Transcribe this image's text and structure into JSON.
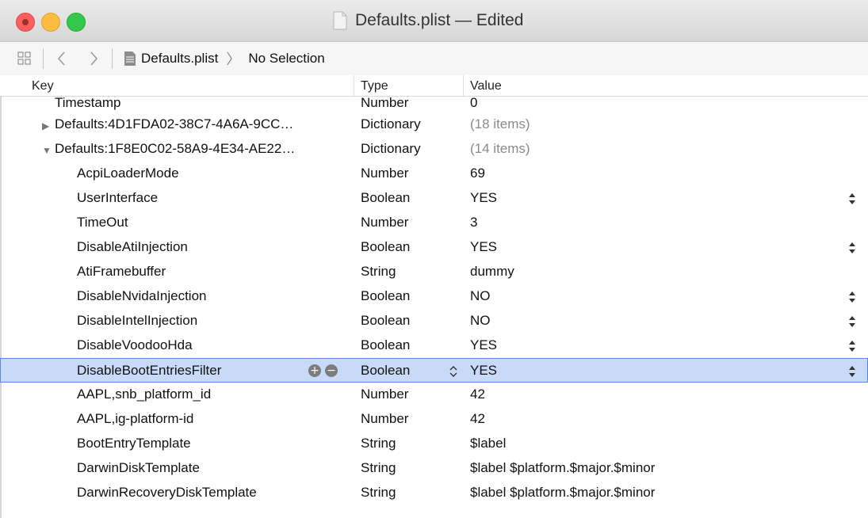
{
  "window": {
    "title": "Defaults.plist — Edited"
  },
  "pathbar": {
    "file": "Defaults.plist",
    "selection": "No Selection"
  },
  "columns": {
    "key": "Key",
    "type": "Type",
    "value": "Value"
  },
  "rows": [
    {
      "key": "Timestamp",
      "type": "Number",
      "value": "0",
      "indent": 1,
      "disclosure": "",
      "muted": false,
      "stepper": false
    },
    {
      "key": "Defaults:4D1FDA02-38C7-4A6A-9CC…",
      "type": "Dictionary",
      "value": "(18 items)",
      "indent": 0,
      "disclosure": "collapsed",
      "muted": true,
      "stepper": false
    },
    {
      "key": "Defaults:1F8E0C02-58A9-4E34-AE22…",
      "type": "Dictionary",
      "value": "(14 items)",
      "indent": 0,
      "disclosure": "expanded",
      "muted": true,
      "stepper": false
    },
    {
      "key": "AcpiLoaderMode",
      "type": "Number",
      "value": "69",
      "indent": 2,
      "disclosure": "",
      "muted": false,
      "stepper": false
    },
    {
      "key": "UserInterface",
      "type": "Boolean",
      "value": "YES",
      "indent": 2,
      "disclosure": "",
      "muted": false,
      "stepper": true
    },
    {
      "key": "TimeOut",
      "type": "Number",
      "value": "3",
      "indent": 2,
      "disclosure": "",
      "muted": false,
      "stepper": false
    },
    {
      "key": "DisableAtiInjection",
      "type": "Boolean",
      "value": "YES",
      "indent": 2,
      "disclosure": "",
      "muted": false,
      "stepper": true
    },
    {
      "key": "AtiFramebuffer",
      "type": "String",
      "value": "dummy",
      "indent": 2,
      "disclosure": "",
      "muted": false,
      "stepper": false
    },
    {
      "key": "DisableNvidaInjection",
      "type": "Boolean",
      "value": "NO",
      "indent": 2,
      "disclosure": "",
      "muted": false,
      "stepper": true
    },
    {
      "key": "DisableIntelInjection",
      "type": "Boolean",
      "value": "NO",
      "indent": 2,
      "disclosure": "",
      "muted": false,
      "stepper": true
    },
    {
      "key": "DisableVoodooHda",
      "type": "Boolean",
      "value": "YES",
      "indent": 2,
      "disclosure": "",
      "muted": false,
      "stepper": true
    },
    {
      "key": "DisableBootEntriesFilter",
      "type": "Boolean",
      "value": "YES",
      "indent": 2,
      "disclosure": "",
      "muted": false,
      "stepper": true,
      "selected": true
    },
    {
      "key": "AAPL,snb_platform_id",
      "type": "Number",
      "value": "42",
      "indent": 2,
      "disclosure": "",
      "muted": false,
      "stepper": false
    },
    {
      "key": "AAPL,ig-platform-id",
      "type": "Number",
      "value": "42",
      "indent": 2,
      "disclosure": "",
      "muted": false,
      "stepper": false
    },
    {
      "key": "BootEntryTemplate",
      "type": "String",
      "value": "$label",
      "indent": 2,
      "disclosure": "",
      "muted": false,
      "stepper": false
    },
    {
      "key": "DarwinDiskTemplate",
      "type": "String",
      "value": "$label $platform.$major.$minor",
      "indent": 2,
      "disclosure": "",
      "muted": false,
      "stepper": false
    },
    {
      "key": "DarwinRecoveryDiskTemplate",
      "type": "String",
      "value": "$label $platform.$major.$minor",
      "indent": 2,
      "disclosure": "",
      "muted": false,
      "stepper": false
    }
  ],
  "selected_row_actions": {
    "add": "+",
    "remove": "−"
  },
  "colors": {
    "selection_bg": "#c9daf8",
    "selection_border": "#5b8ad8",
    "muted_text": "#8a8a8a"
  }
}
